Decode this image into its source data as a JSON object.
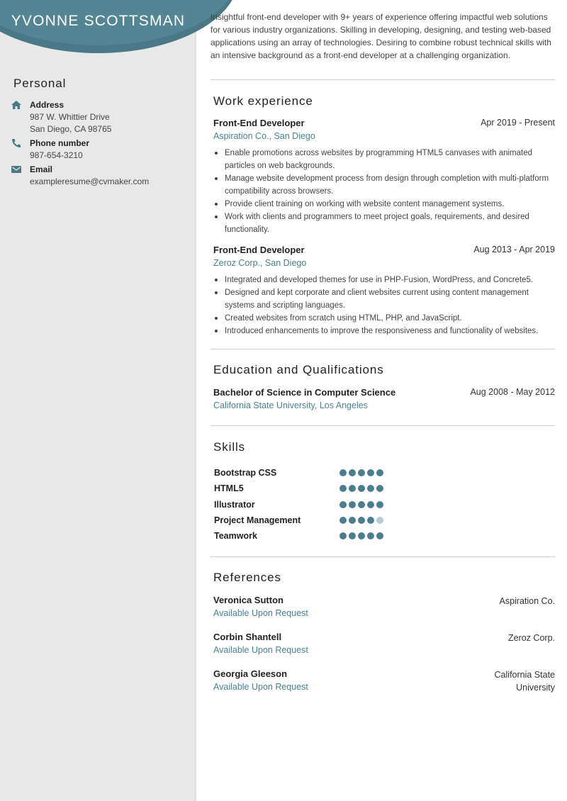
{
  "header": {
    "name": "YVONNE SCOTTSMAN"
  },
  "sidebar": {
    "section_title": "Personal",
    "contacts": [
      {
        "icon": "home-icon",
        "label": "Address",
        "lines": [
          "987 W. Whittier Drive",
          "San Diego, CA 98765"
        ]
      },
      {
        "icon": "phone-icon",
        "label": "Phone number",
        "lines": [
          "987-654-3210"
        ]
      },
      {
        "icon": "email-icon",
        "label": "Email",
        "lines": [
          "exampleresume@cvmaker.com"
        ]
      }
    ]
  },
  "summary": "Insightful front-end developer with 9+ years of experience offering impactful web solutions for various industry organizations. Skilling in developing, designing, and testing web-based applications using an array of technologies. Desiring to combine robust technical skills with an intensive background as a front-end developer at a challenging organization.",
  "work": {
    "title": "Work experience",
    "jobs": [
      {
        "title": "Front-End Developer",
        "company": "Aspiration Co., San Diego",
        "dates": "Apr 2019 - Present",
        "bullets": [
          "Enable promotions across websites by programming HTML5 canvases with animated particles on web backgrounds.",
          "Manage website development process from design through completion with multi-platform compatibility across browsers.",
          "Provide client training on working with website content management systems.",
          "Work with clients and programmers to meet project goals, requirements, and desired functionality."
        ]
      },
      {
        "title": "Front-End Developer",
        "company": "Zeroz Corp., San Diego",
        "dates": "Aug 2013 - Apr 2019",
        "bullets": [
          "Integrated and developed themes for use in PHP-Fusion, WordPress, and Concrete5.",
          "Designed and kept corporate and client websites current using content management systems and scripting languages.",
          "Created websites from scratch using HTML, PHP, and JavaScript.",
          "Introduced enhancements to improve the responsiveness and functionality of websites."
        ]
      }
    ]
  },
  "education": {
    "title": "Education and Qualifications",
    "items": [
      {
        "degree": "Bachelor of Science in Computer Science",
        "school": "California State University, Los Angeles",
        "dates": "Aug 2008 - May 2012"
      }
    ]
  },
  "skills": {
    "title": "Skills",
    "max": 5,
    "items": [
      {
        "name": "Bootstrap CSS",
        "level": 5
      },
      {
        "name": "HTML5",
        "level": 5
      },
      {
        "name": "Illustrator",
        "level": 5
      },
      {
        "name": "Project Management",
        "level": 4
      },
      {
        "name": "Teamwork",
        "level": 5
      }
    ]
  },
  "references": {
    "title": "References",
    "items": [
      {
        "name": "Veronica Sutton",
        "note": "Available Upon Request",
        "company": "Aspiration Co."
      },
      {
        "name": "Corbin Shantell",
        "note": "Available Upon Request",
        "company": "Zeroz Corp."
      },
      {
        "name": "Georgia Gleeson",
        "note": "Available Upon Request",
        "company": "California State University"
      }
    ]
  },
  "colors": {
    "accent": "#538595",
    "accent_dark": "#4a7886",
    "link": "#4a8090",
    "sidebar_bg": "#e8e8e8",
    "dot_off": "#b7ccd2"
  }
}
